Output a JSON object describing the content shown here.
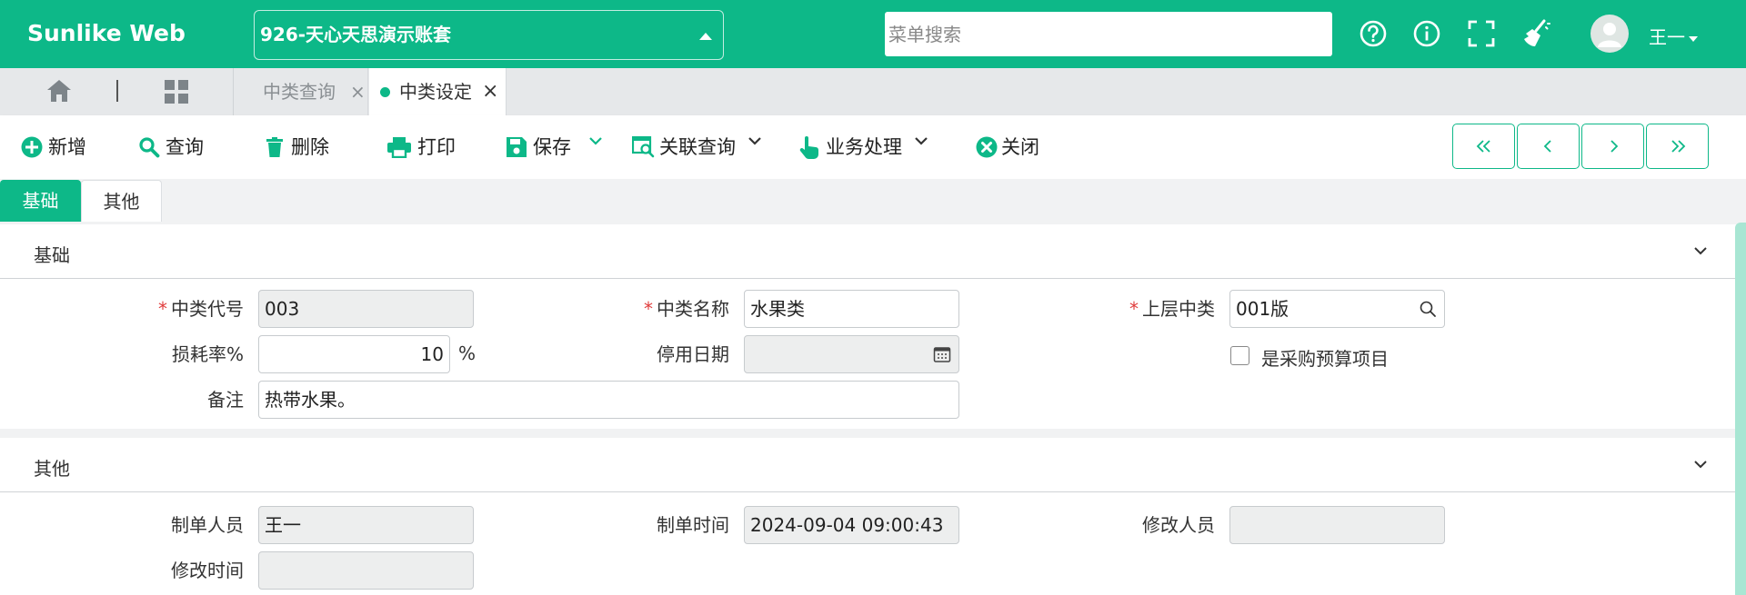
{
  "header": {
    "brand": "Sunlike Web",
    "account": "926-天心天思演示账套",
    "menu_search_placeholder": "菜单搜索",
    "icons": [
      "help-icon",
      "info-icon",
      "fullscreen-icon",
      "broom-icon"
    ],
    "user": "王一"
  },
  "tabs": [
    {
      "label": "中类查询",
      "active": false
    },
    {
      "label": "中类设定",
      "active": true
    }
  ],
  "toolbar": {
    "add": "新增",
    "query": "查询",
    "delete": "删除",
    "print": "打印",
    "save": "保存",
    "related_query": "关联查询",
    "business": "业务处理",
    "close": "关闭"
  },
  "panel_tabs": [
    "基础",
    "其他"
  ],
  "sections": {
    "basic": {
      "title": "基础",
      "fields": {
        "code": {
          "label": "中类代号",
          "value": "003",
          "required": true
        },
        "name": {
          "label": "中类名称",
          "value": "水果类",
          "required": true
        },
        "parent": {
          "label": "上层中类",
          "value": "001版",
          "required": true
        },
        "loss_rate": {
          "label": "损耗率%",
          "value": "10",
          "unit": "%"
        },
        "stop_date": {
          "label": "停用日期",
          "value": ""
        },
        "budget_item": {
          "label": "是采购预算项目",
          "checked": false
        },
        "remark": {
          "label": "备注",
          "value": "热带水果。"
        }
      }
    },
    "other": {
      "title": "其他",
      "fields": {
        "creator": {
          "label": "制单人员",
          "value": "王一"
        },
        "create_time": {
          "label": "制单时间",
          "value": "2024-09-04 09:00:43"
        },
        "modifier": {
          "label": "修改人员",
          "value": ""
        },
        "modify_time": {
          "label": "修改时间",
          "value": ""
        }
      }
    }
  },
  "colors": {
    "primary": "#0db888",
    "required": "#e03b3b"
  }
}
